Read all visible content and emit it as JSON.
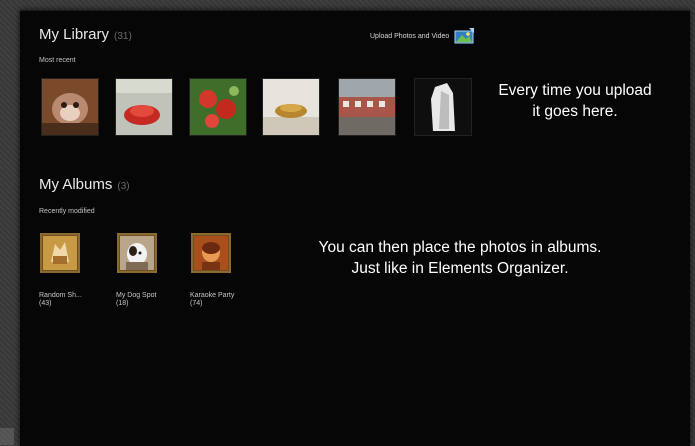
{
  "library": {
    "title": "My Library",
    "count": "(31)",
    "upload_label": "Upload Photos and Video",
    "section_label": "Most recent",
    "photos": [
      {
        "alt": "photo-1"
      },
      {
        "alt": "photo-2"
      },
      {
        "alt": "photo-3"
      },
      {
        "alt": "photo-4"
      },
      {
        "alt": "photo-5"
      },
      {
        "alt": "photo-6"
      }
    ]
  },
  "callouts": {
    "upload_note_line1": "Every time you upload",
    "upload_note_line2": "it goes here.",
    "albums_note_line1": "You can then place the photos in albums.",
    "albums_note_line2": "Just like in Elements Organizer."
  },
  "albums": {
    "title": "My Albums",
    "count": "(3)",
    "section_label": "Recently modified",
    "items": [
      {
        "name": "Random Sh...",
        "count": "(43)"
      },
      {
        "name": "My Dog Spot",
        "count": "(18)"
      },
      {
        "name": "Karaoke Party",
        "count": "(74)"
      }
    ]
  },
  "colors": {
    "panel_bg": "#060606",
    "text": "#e9e9e9",
    "album_frame": "#6c4f22"
  }
}
